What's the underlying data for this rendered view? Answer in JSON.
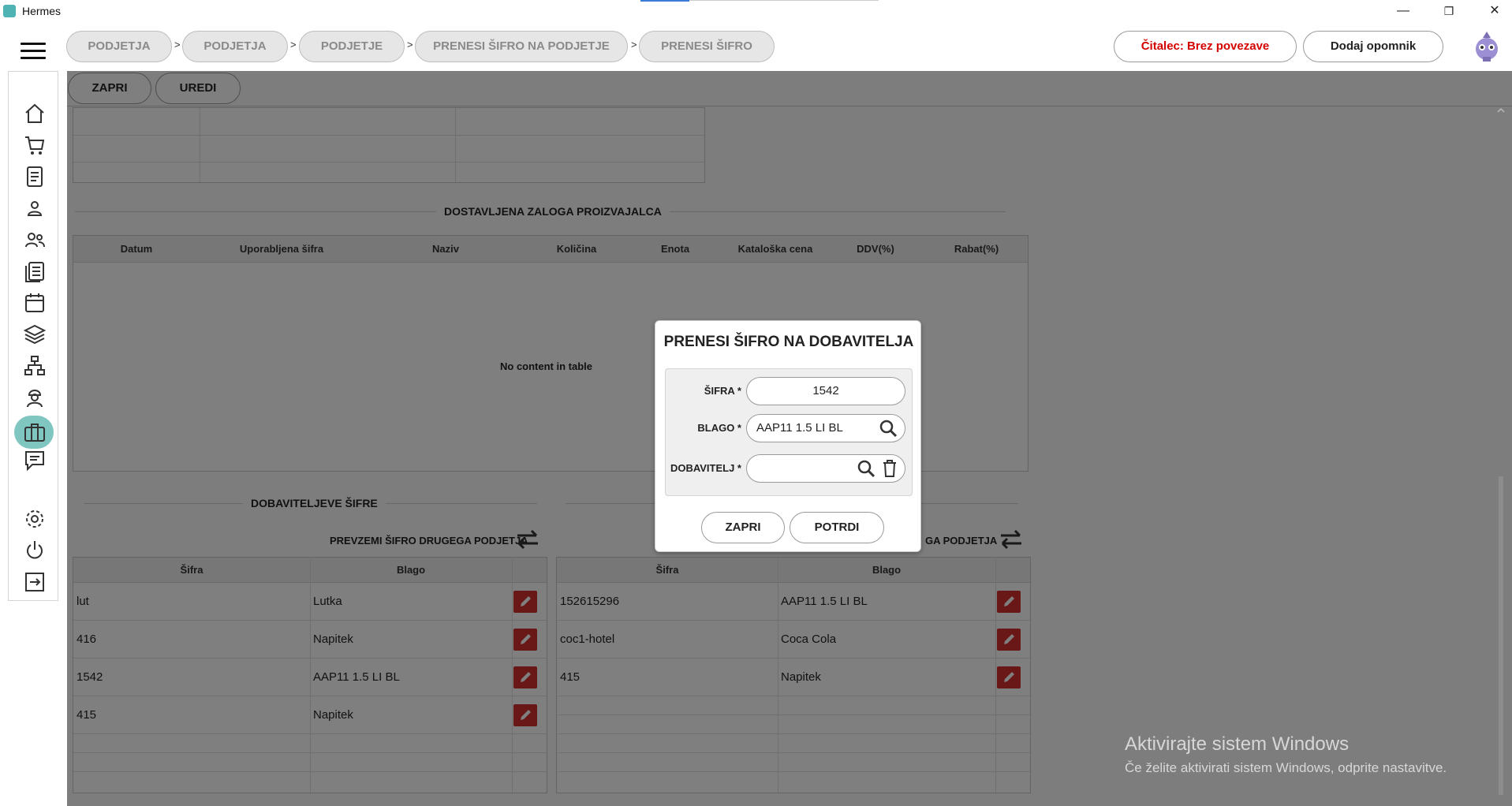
{
  "app": {
    "title": "Hermes"
  },
  "window_controls": {
    "minimize": "—",
    "restore": "❐",
    "close": "✕"
  },
  "breadcrumbs": [
    "PODJETJA",
    "PODJETJA",
    "PODJETJE",
    "PRENESI ŠIFRO NA PODJETJE",
    "PRENESI ŠIFRO"
  ],
  "breadcrumb_separator": ">",
  "header": {
    "reader_status": "Čitalec: Brez povezave",
    "add_reminder": "Dodaj opomnik"
  },
  "toolbar": {
    "close": "ZAPRI",
    "edit": "UREDI"
  },
  "delivered_stock": {
    "title": "DOSTAVLJENA ZALOGA PROIZVAJALCA",
    "columns": [
      "Datum",
      "Uporabljena šifra",
      "Naziv",
      "Količina",
      "Enota",
      "Kataloška cena",
      "DDV(%)",
      "Rabat(%)"
    ],
    "empty": "No content in table"
  },
  "supplier_codes": {
    "title": "DOBAVITELJEVE ŠIFRE",
    "take_over_label": "PREVZEMI ŠIFRO DRUGEGA PODJETJA",
    "right_label": "GA PODJETJA",
    "columns": [
      "Šifra",
      "Blago"
    ],
    "left_rows": [
      {
        "code": "lut",
        "item": "Lutka"
      },
      {
        "code": "416",
        "item": "Napitek"
      },
      {
        "code": "1542",
        "item": "AAP11 1.5 LI BL"
      },
      {
        "code": "415",
        "item": "Napitek"
      }
    ],
    "right_rows": [
      {
        "code": "152615296",
        "item": "AAP11 1.5 LI BL"
      },
      {
        "code": "coc1-hotel",
        "item": "Coca Cola"
      },
      {
        "code": "415",
        "item": "Napitek"
      }
    ]
  },
  "modal": {
    "title": "PRENESI ŠIFRO NA DOBAVITELJA",
    "fields": {
      "code": {
        "label": "ŠIFRA *",
        "value": "1542"
      },
      "item": {
        "label": "BLAGO *",
        "value": "AAP11 1.5 LI BL"
      },
      "supplier": {
        "label": "DOBAVITELJ *",
        "value": ""
      }
    },
    "close": "ZAPRI",
    "confirm": "POTRDI"
  },
  "watermark": {
    "line1": "Aktivirajte sistem Windows",
    "line2": "Če želite aktivirati sistem Windows, odprite nastavitve."
  },
  "colors": {
    "accent_teal": "#7fc6c0",
    "danger_red": "#d40000",
    "edit_red": "#d32f2f"
  },
  "sidebar_icons": [
    "home-icon",
    "cart-icon",
    "document-icon",
    "person-icon",
    "people-icon",
    "list-icon",
    "calendar-icon",
    "layers-icon",
    "network-icon",
    "worker-icon",
    "briefcase-icon",
    "chat-icon",
    "gear-icon",
    "power-icon",
    "logout-icon"
  ]
}
